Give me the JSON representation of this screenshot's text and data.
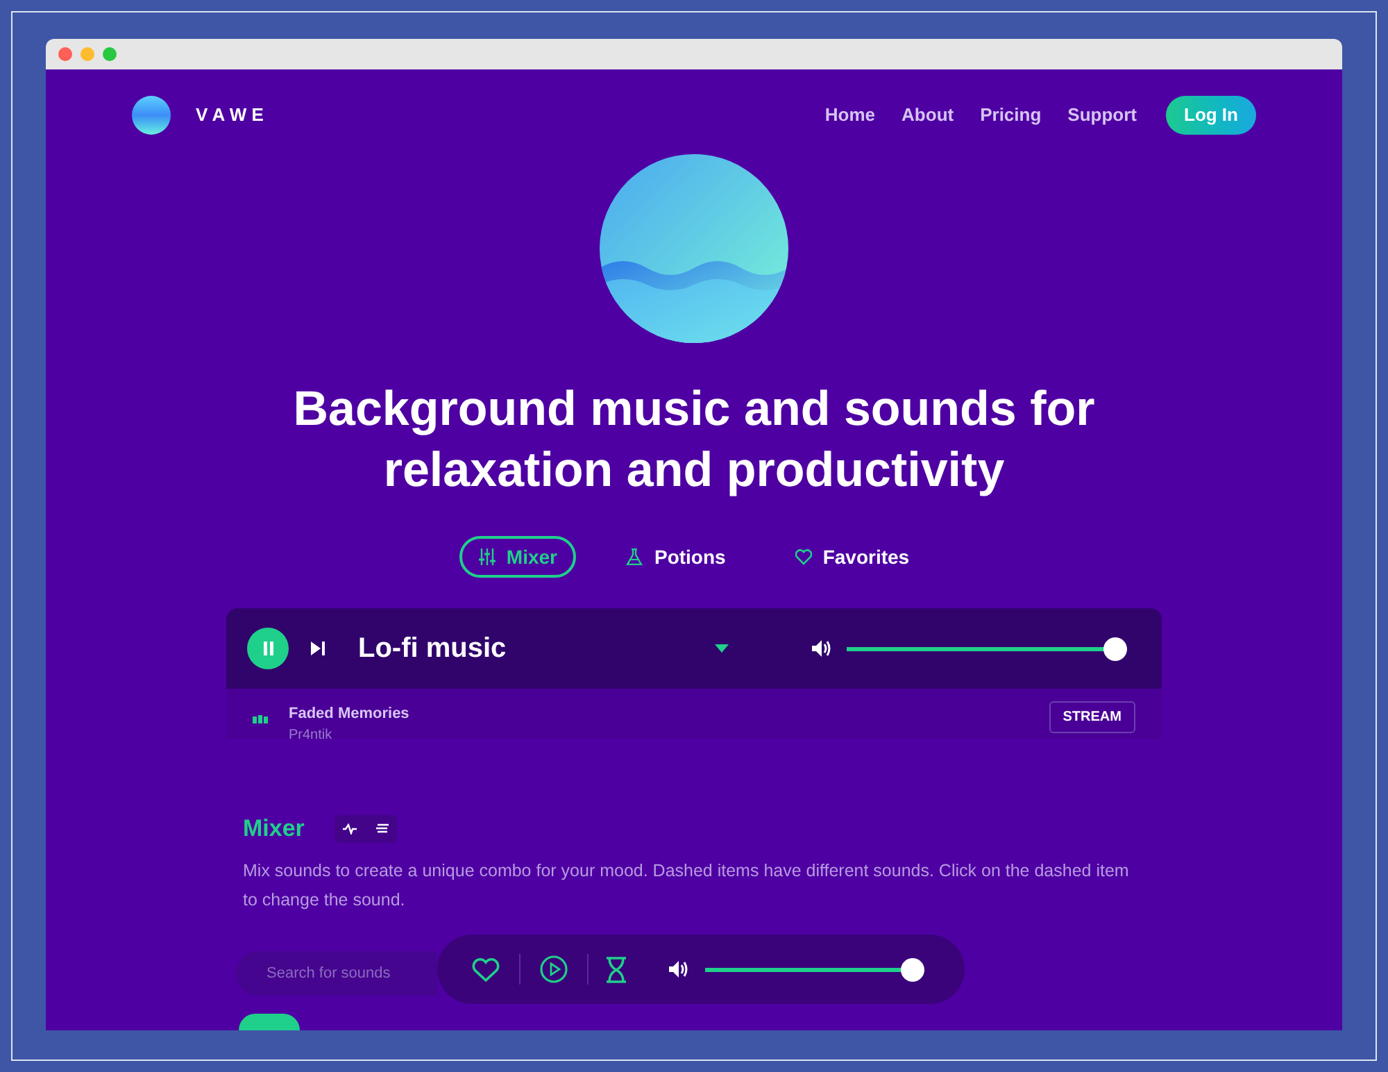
{
  "brand": {
    "name": "V A W E"
  },
  "nav": {
    "links": [
      "Home",
      "About",
      "Pricing",
      "Support"
    ],
    "login": "Log In"
  },
  "hero": {
    "heading": "Background music and sounds for relaxation and productivity"
  },
  "tabs": [
    {
      "label": "Mixer",
      "selected": true
    },
    {
      "label": "Potions",
      "selected": false
    },
    {
      "label": "Favorites",
      "selected": false
    }
  ],
  "player": {
    "title": "Lo-fi music",
    "playing": true,
    "volume": {
      "level": 1
    }
  },
  "track": {
    "title": "Faded Memories",
    "artist": "Pr4ntik",
    "action": "STREAM"
  },
  "mixer": {
    "title": "Mixer",
    "description": "Mix sounds to create a unique combo for your mood. Dashed items have different sounds. Click on the dashed item to change the sound.",
    "search": {
      "placeholder": "Search for sounds"
    }
  },
  "bottom_bar": {
    "volume": {
      "level": 1
    }
  }
}
